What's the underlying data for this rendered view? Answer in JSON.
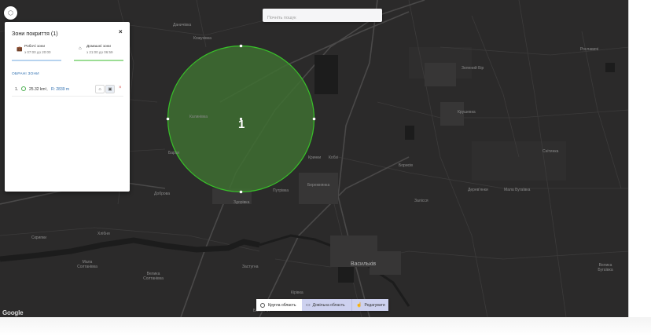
{
  "search": {
    "placeholder": "Почніть пошук"
  },
  "panel": {
    "title": "Зони покриття (1)",
    "close": "×",
    "work_zone": {
      "name": "Робочі зони",
      "time": "з 07:00 до 20:00",
      "icon": "briefcase-icon"
    },
    "home_zone": {
      "name": "Домашні зони",
      "time": "з 21:00 до 06:59",
      "icon": "house-icon"
    },
    "section_title": "ОБРАНІ ЗОНИ",
    "zones": [
      {
        "index": "1.",
        "area": "25.32 km²,",
        "radius": "R: 2839 m",
        "delete": "×"
      }
    ]
  },
  "map": {
    "zone_number": "1",
    "attribution": "Google",
    "labels": {
      "damyankova": "Даничівка",
      "kozhukhivka": "Кожухівка",
      "kalynivka": "Калинівка",
      "barakh": "Бархи",
      "dobrova": "Доброва",
      "khlebnyi": "Хлібня",
      "skrypky": "Скрипки",
      "mala_soltanivka": "Мала Солтанівка",
      "velyka_soltanivka": "Велика Солтанівка",
      "zdorivka": "Здорівка",
      "putryvka": "Путрівка",
      "zastugna": "Застугна",
      "krynky": "Кринки",
      "kobza": "Кобзі",
      "berezhnyanka": "Бережнянка",
      "borysiv": "Борисів",
      "zalissia": "Залісся",
      "derevianky": "Дерев'янки",
      "mala_buhaivka": "Мала Бугаївка",
      "krushevka": "Крушевка",
      "zelenyi_bir": "Зелений Бір",
      "roslavych": "Рославичі",
      "vasylkiv": "Васильків",
      "velyka_buhaivka": "Велика Бугаївка",
      "kriakhivka": "Кірівка",
      "vasylchyn": "Басилічи",
      "snyb": "Снітинка"
    },
    "zone_fill": "#3e6f31",
    "zone_stroke": "#38c229"
  },
  "toolbar": {
    "round_area": "Кругла область",
    "free_area": "Довільна область",
    "edit": "Редагувати"
  }
}
